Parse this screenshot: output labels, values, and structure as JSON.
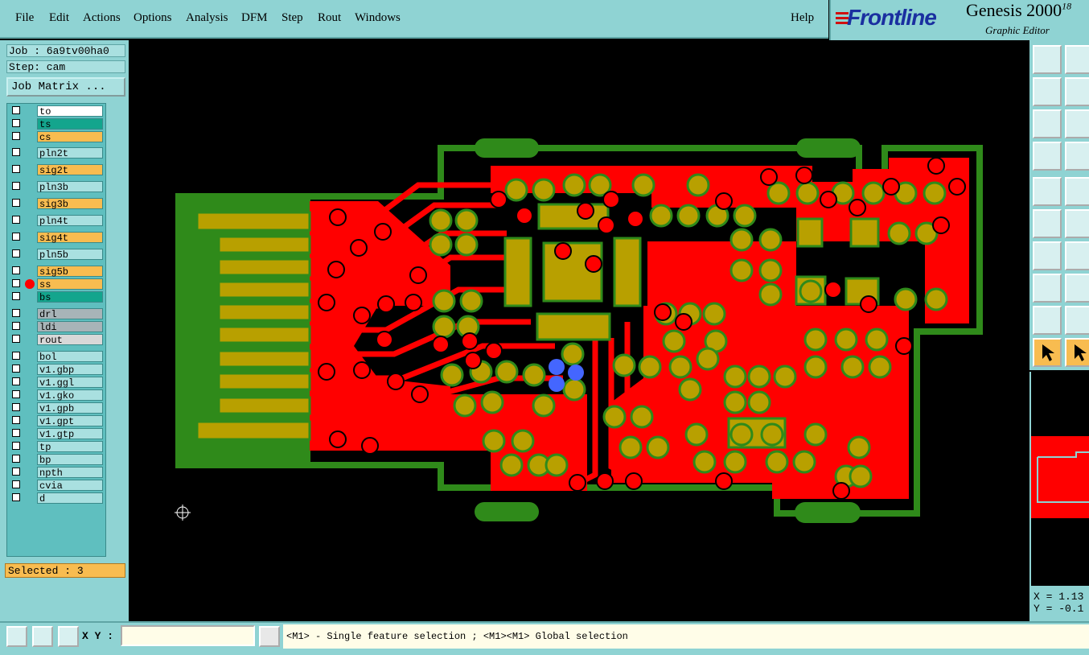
{
  "menu": {
    "items": [
      "File",
      "Edit",
      "Actions",
      "Options",
      "Analysis",
      "DFM",
      "Step",
      "Rout",
      "Windows"
    ],
    "help": "Help"
  },
  "brand": {
    "logo_text": "Frontline",
    "product": "Genesis 2000",
    "version_superscript": "18",
    "subtitle": "Graphic Editor"
  },
  "job": {
    "job_line": "Job : 6a9tv00ha0",
    "step_line": "Step: cam",
    "matrix_button": "Job Matrix ..."
  },
  "layers": [
    {
      "name": "to",
      "color": "#ffffff"
    },
    {
      "name": "ts",
      "color": "#13a58d"
    },
    {
      "name": "cs",
      "color": "#f8bc50"
    },
    {
      "name": "pln2t",
      "color": "#a9e0e0"
    },
    {
      "name": "sig2t",
      "color": "#f8bc50"
    },
    {
      "name": "pln3b",
      "color": "#a9e0e0"
    },
    {
      "name": "sig3b",
      "color": "#f8bc50"
    },
    {
      "name": "pln4t",
      "color": "#a9e0e0"
    },
    {
      "name": "sig4t",
      "color": "#f8bc50"
    },
    {
      "name": "pln5b",
      "color": "#a9e0e0"
    },
    {
      "name": "sig5b",
      "color": "#f8bc50"
    },
    {
      "name": "ss",
      "color": "#f8bc50"
    },
    {
      "name": "bs",
      "color": "#13a58d"
    },
    {
      "name": "drl",
      "color": "#a8b4b8"
    },
    {
      "name": "ldi",
      "color": "#a8b4b8"
    },
    {
      "name": "rout",
      "color": "#d8d8d8"
    },
    {
      "name": "bol",
      "color": "#a9e0e0"
    },
    {
      "name": "v1.gbp",
      "color": "#a9e0e0"
    },
    {
      "name": "v1.ggl",
      "color": "#a9e0e0"
    },
    {
      "name": "v1.gko",
      "color": "#a9e0e0"
    },
    {
      "name": "v1.gpb",
      "color": "#a9e0e0"
    },
    {
      "name": "v1.gpt",
      "color": "#a9e0e0"
    },
    {
      "name": "v1.gtp",
      "color": "#a9e0e0"
    },
    {
      "name": "tp",
      "color": "#a9e0e0"
    },
    {
      "name": "bp",
      "color": "#a9e0e0"
    },
    {
      "name": "npth",
      "color": "#a9e0e0"
    },
    {
      "name": "cvia",
      "color": "#a9e0e0"
    },
    {
      "name": "d",
      "color": "#a9e0e0"
    }
  ],
  "status": {
    "selected": "Selected : 3",
    "coords": "X = 1.13\nY = -0.1"
  },
  "bottom": {
    "xy_label": "X Y :",
    "xy_value": "",
    "message": "<M1> - Single feature selection ; <M1><M1> Global selection"
  },
  "colors": {
    "panel": "#8fd3d3",
    "copper": "#ff0000",
    "pad": "#b8a000",
    "mask": "#2f8a1a",
    "selected": "#4466ff",
    "highlight": "#f8bc50"
  }
}
